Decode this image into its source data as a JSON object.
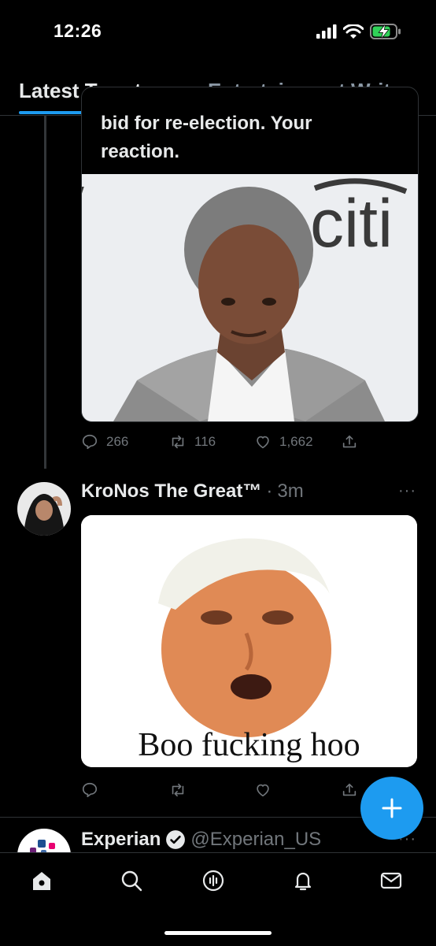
{
  "status_bar": {
    "time": "12:26"
  },
  "tabs": [
    {
      "label": "Latest Tweets"
    },
    {
      "label": "Entertainment Write"
    }
  ],
  "quoted_tweet": {
    "text_line1": "bid for re-election. Your",
    "text_line2": "reaction.",
    "image_sign_text": "citi"
  },
  "tweet1_actions": {
    "replies": "266",
    "retweets": "116",
    "likes": "1,662"
  },
  "tweet2": {
    "author": "KroNos The Great™",
    "separator": "·",
    "time": "3m",
    "more": "···",
    "image_caption": "Boo fucking hoo"
  },
  "tweet3": {
    "author": "Experian",
    "handle": "@Experian_US",
    "more": "···"
  },
  "colors": {
    "accent": "#1d9bf0",
    "muted": "#71767b",
    "background": "#000000"
  },
  "icons": {
    "bottom_nav": [
      "home-icon",
      "search-icon",
      "spaces-icon",
      "notifications-icon",
      "messages-icon"
    ],
    "fab": "compose-plus-icon"
  }
}
